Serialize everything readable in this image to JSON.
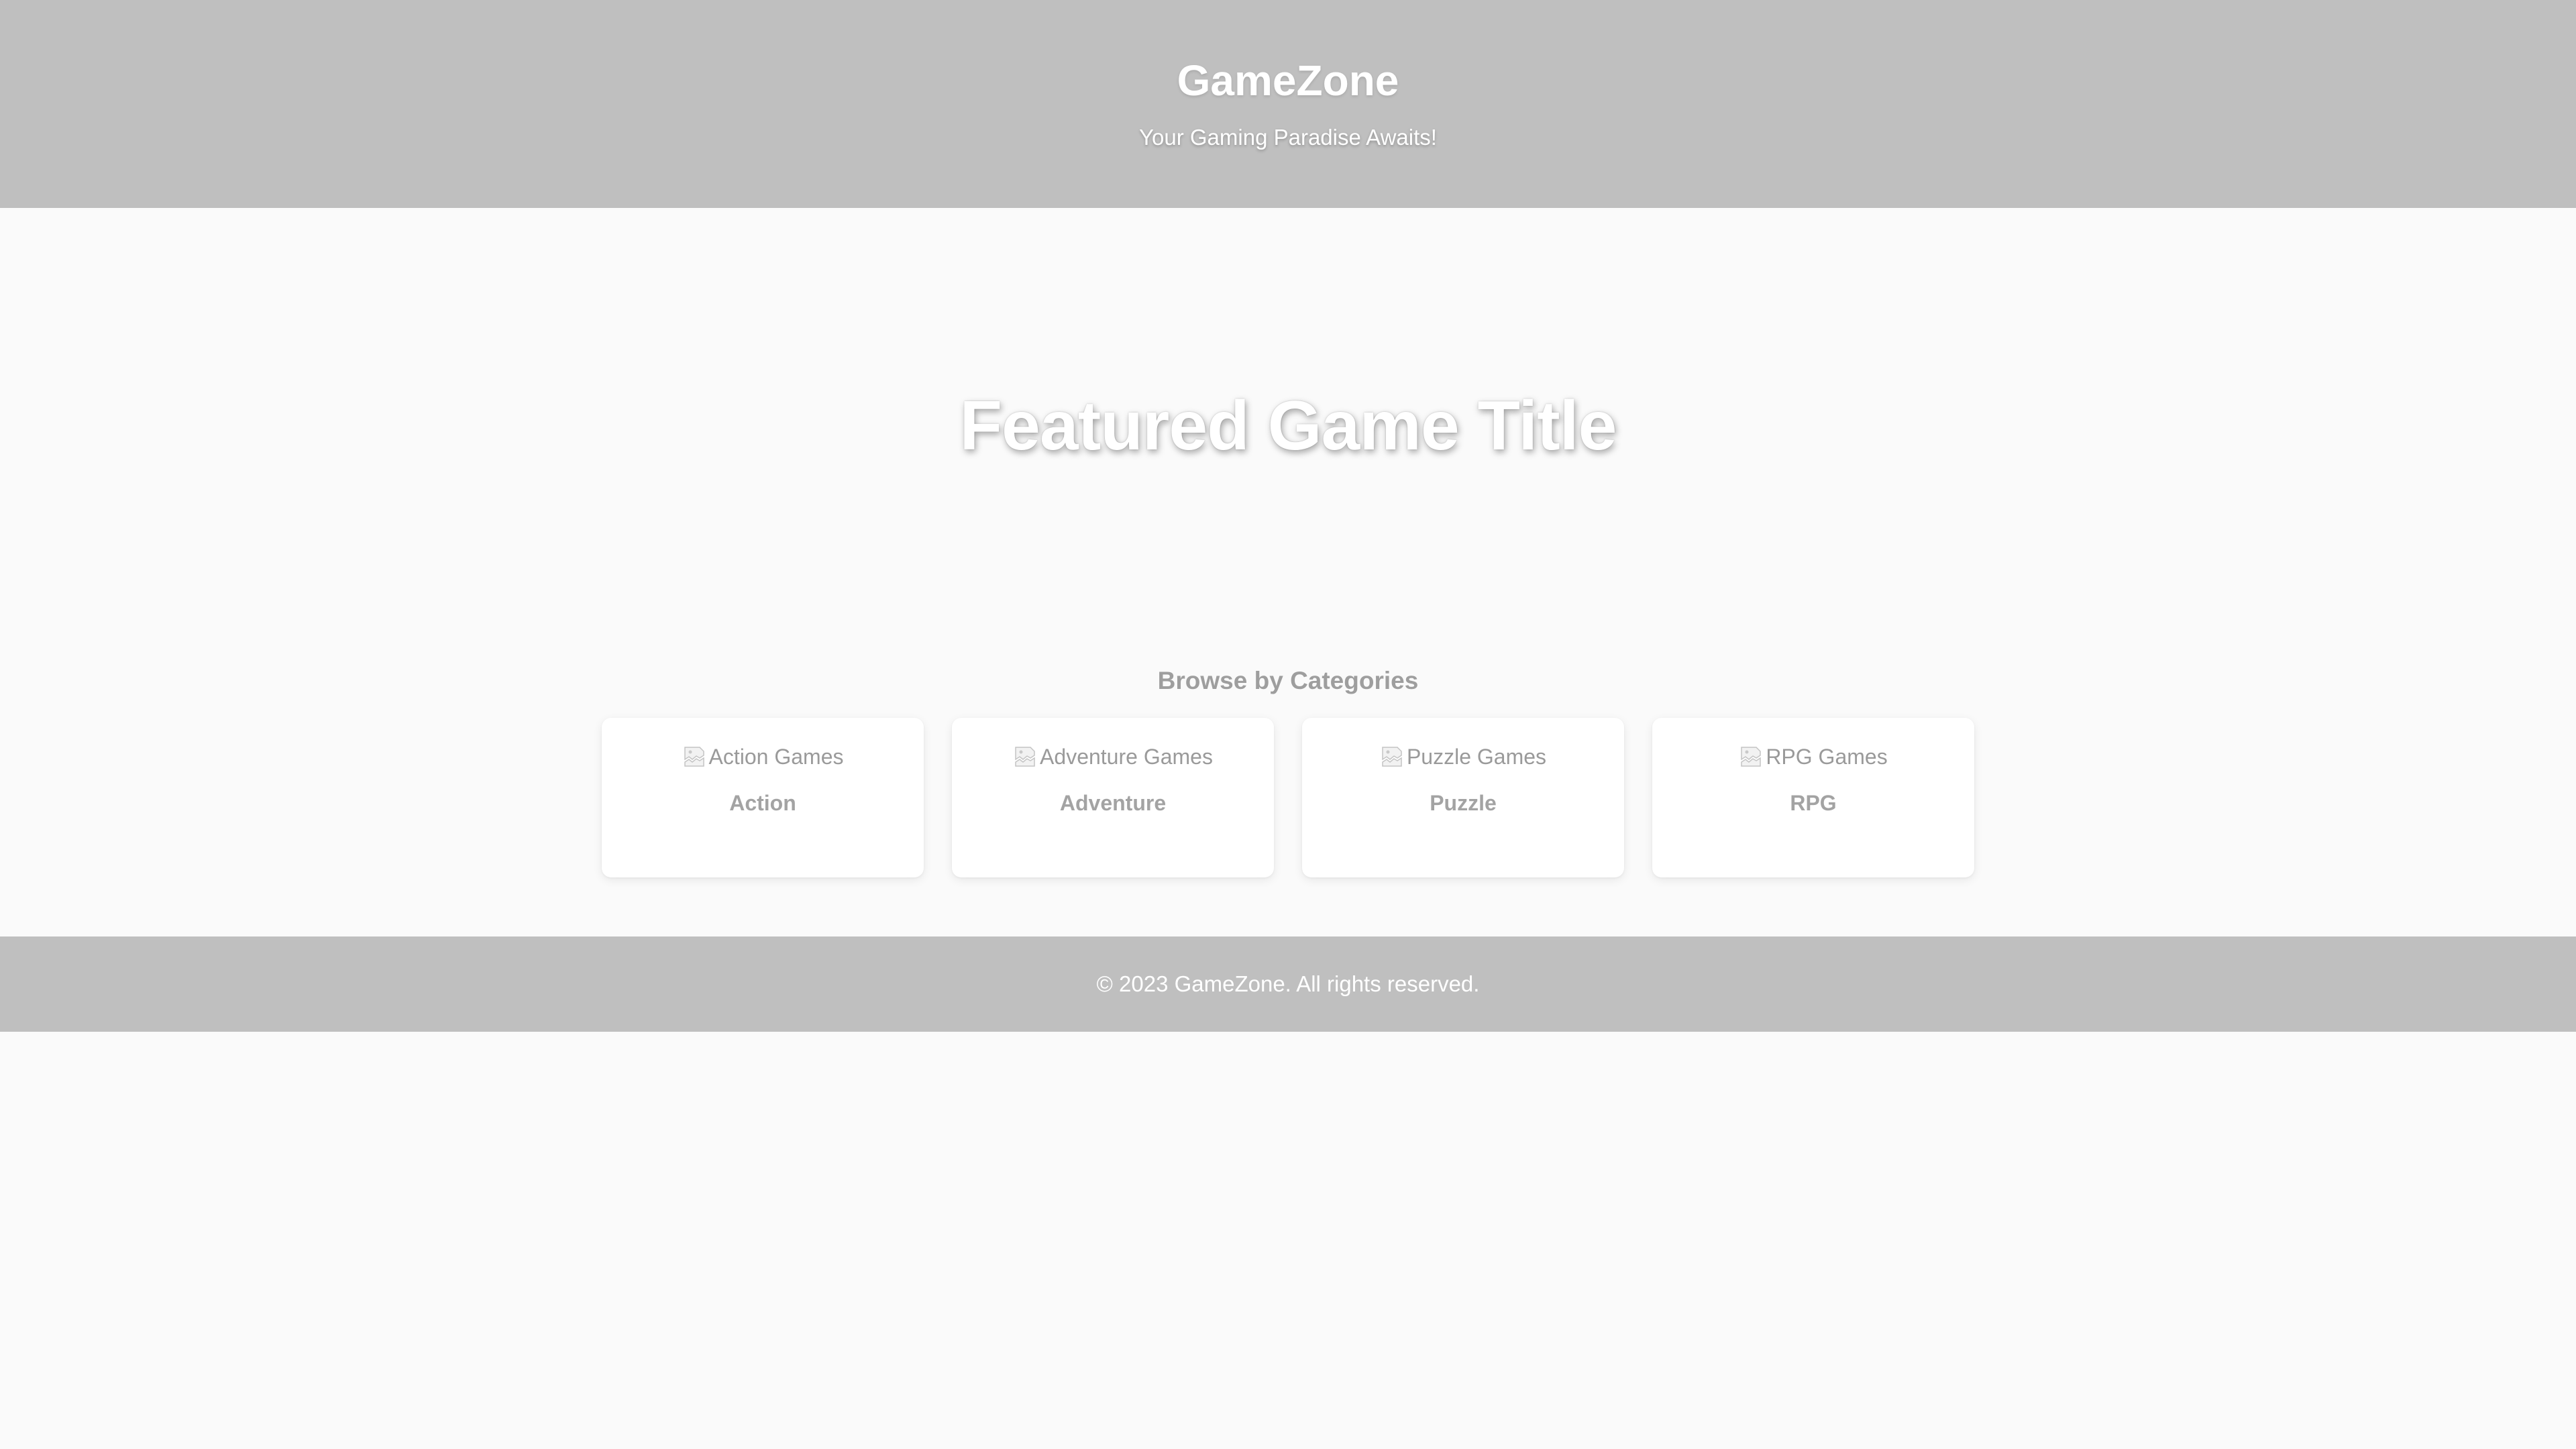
{
  "header": {
    "title": "GameZone",
    "tagline": "Your Gaming Paradise Awaits!"
  },
  "hero": {
    "title": "Featured Game Title"
  },
  "categories": {
    "heading": "Browse by Categories",
    "items": [
      {
        "image_alt": "Action Games",
        "name": "Action",
        "icon": "broken-image-icon"
      },
      {
        "image_alt": "Adventure Games",
        "name": "Adventure",
        "icon": "broken-image-icon"
      },
      {
        "image_alt": "Puzzle Games",
        "name": "Puzzle",
        "icon": "broken-image-icon"
      },
      {
        "image_alt": "RPG Games",
        "name": "RPG",
        "icon": "broken-image-icon"
      }
    ]
  },
  "footer": {
    "copyright": "© 2023 GameZone. All rights reserved."
  },
  "colors": {
    "header_bg": "#bfbfbf",
    "page_bg": "#fafafa",
    "card_bg": "#ffffff",
    "footer_bg": "#bfbfbf"
  }
}
